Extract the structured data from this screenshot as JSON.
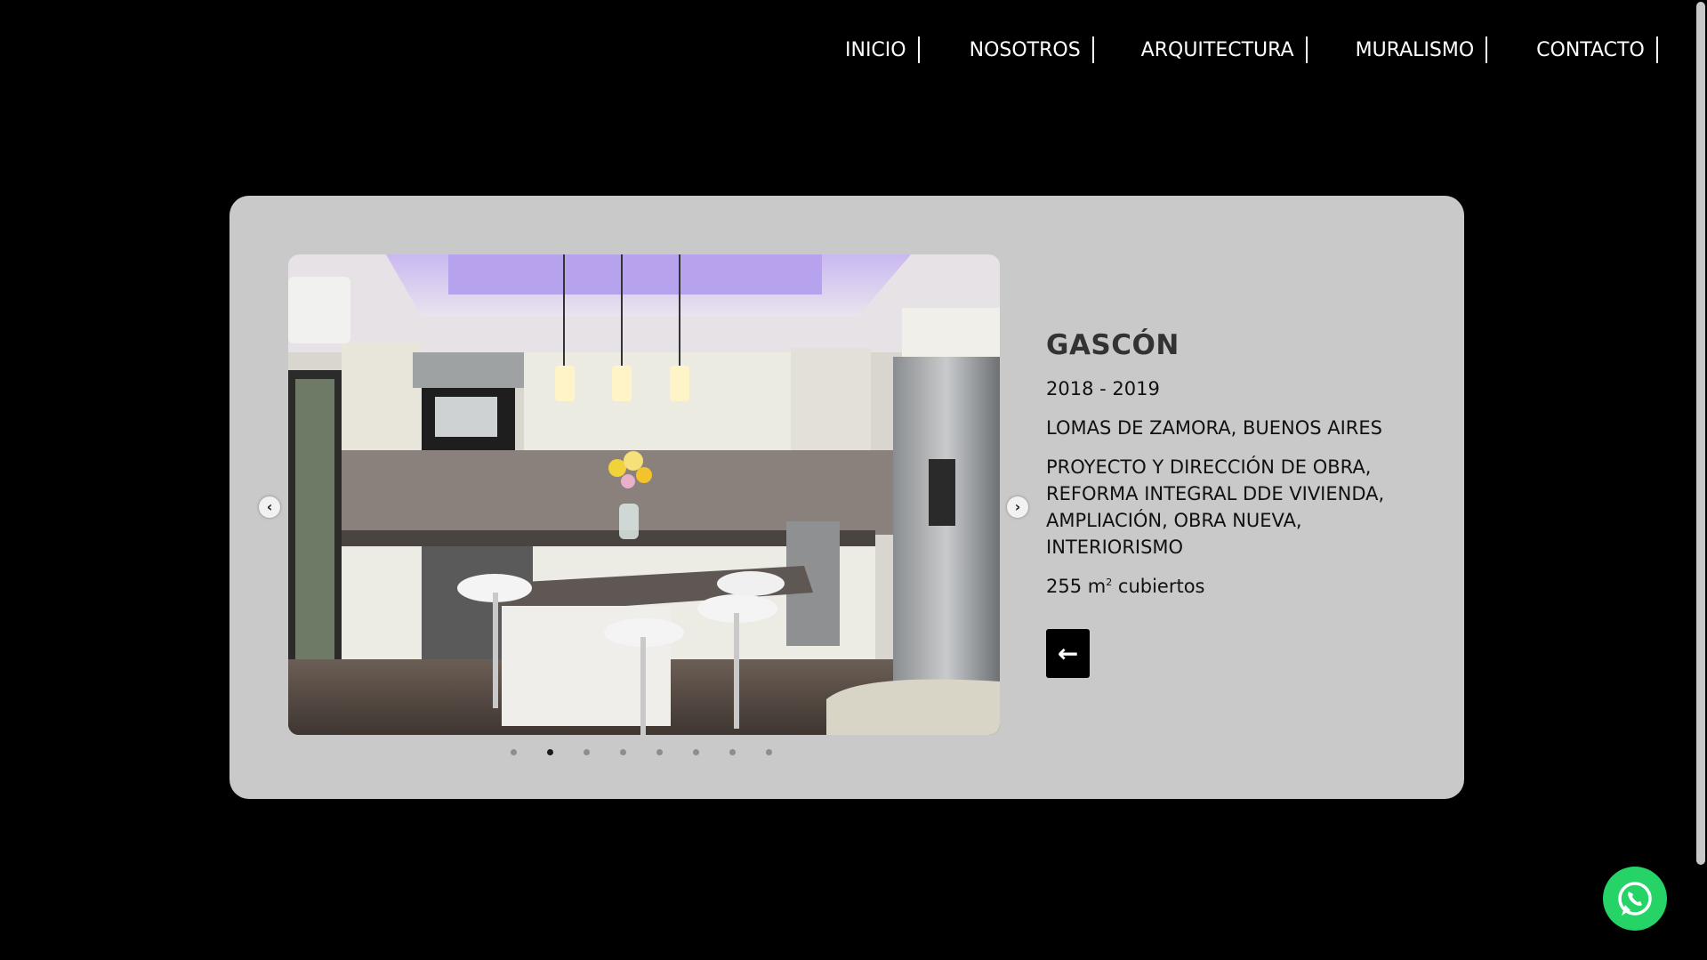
{
  "nav": {
    "items": [
      {
        "label": "INICIO"
      },
      {
        "label": "NOSOTROS"
      },
      {
        "label": "ARQUITECTURA"
      },
      {
        "label": "MURALISMO"
      },
      {
        "label": "CONTACTO"
      }
    ]
  },
  "project": {
    "title": "GASCÓN",
    "years": "2018 - 2019",
    "location": "LOMAS DE ZAMORA, BUENOS AIRES",
    "scope_lines": [
      "PROYECTO Y DIRECCIÓN DE OBRA,",
      "REFORMA INTEGRAL DDE VIVIENDA,",
      "AMPLIACIÓN, OBRA NUEVA,",
      "INTERIORISMO"
    ],
    "area_value": "255 m",
    "area_sup": "2",
    "area_unit": " cubiertos"
  },
  "carousel": {
    "slide_count": 8,
    "active_index": 1,
    "prev_icon": "chevron-left-icon",
    "next_icon": "chevron-right-icon"
  },
  "icons": {
    "back": "arrow-left-icon",
    "whatsapp": "whatsapp-icon"
  },
  "colors": {
    "background": "#000000",
    "card": "#c9c9c9",
    "whatsapp": "#25d366"
  }
}
